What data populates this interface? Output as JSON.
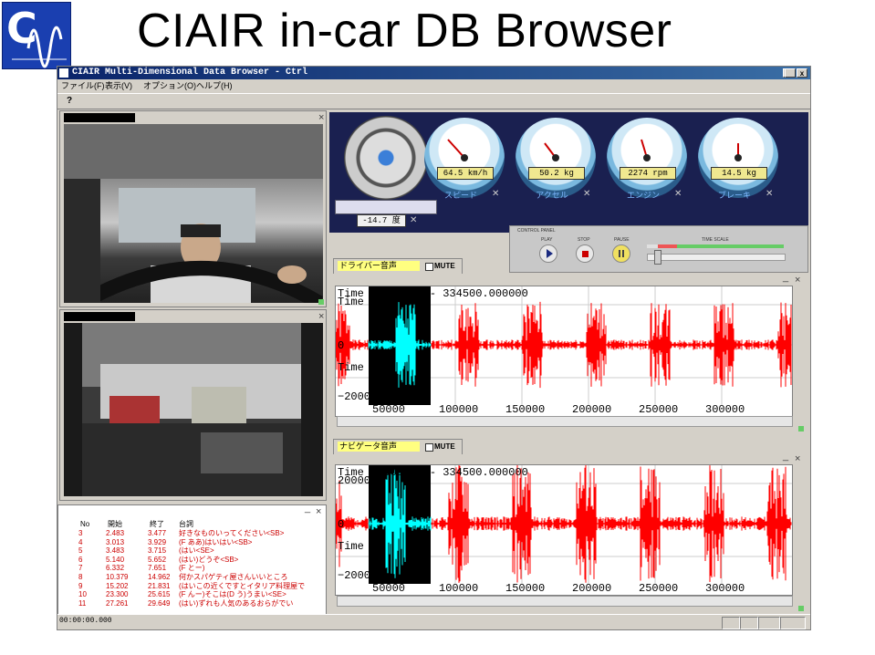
{
  "slide": {
    "title": "CIAIR in-car DB Browser"
  },
  "window": {
    "title": "CIAIR Multi-Dimensional Data Browser - Ctrl",
    "controls": [
      "_",
      "«",
      "x"
    ],
    "menu": [
      "ファイル(F)",
      "表示(V)",
      "オプション(O)",
      "ヘルプ(H)"
    ],
    "help_icon": "?"
  },
  "gauges": {
    "steering": {
      "value": "-14.7 度"
    },
    "dials": [
      {
        "value": "64.5 km/h",
        "label": "スピード",
        "icon": "speed-gauge-icon"
      },
      {
        "value": "50.2 kg",
        "label": "アクセル",
        "icon": "accel-gauge-icon"
      },
      {
        "value": "2274 rpm",
        "label": "エンジン",
        "icon": "engine-gauge-icon"
      },
      {
        "value": "14.5 kg",
        "label": "ブレーキ",
        "icon": "brake-gauge-icon"
      }
    ]
  },
  "control_panel": {
    "title": "CONTROL PANEL",
    "play": "PLAY",
    "stop": "STOP",
    "pause": "PAUSE",
    "time_scale": "TIME SCALE"
  },
  "waves": [
    {
      "tab": "ドライバー音声",
      "mute": "MUTE",
      "time": "Time 0.000000 - 334500.000000",
      "y_labels": [
        "Time",
        "0",
        "Time",
        "−20000"
      ],
      "x_ticks": [
        "50000",
        "100000",
        "150000",
        "200000",
        "250000",
        "300000"
      ]
    },
    {
      "tab": "ナビゲータ音声",
      "mute": "MUTE",
      "time": "Time 0.000000 - 334500.000000",
      "y_labels": [
        "20000",
        "0",
        "Time",
        "−20000"
      ],
      "x_ticks": [
        "50000",
        "100000",
        "150000",
        "200000",
        "250000",
        "300000"
      ]
    }
  ],
  "transcript": {
    "headers": [
      "No",
      "開始",
      "終了",
      "台詞"
    ],
    "rows": [
      [
        "3",
        "2.483",
        "3.477",
        "好きなものいってください<SB>"
      ],
      [
        "4",
        "3.013",
        "3.929",
        "(F ああ)はいはい<SB>"
      ],
      [
        "5",
        "3.483",
        "3.715",
        "(はい<SE>"
      ],
      [
        "6",
        "5.140",
        "5.652",
        "(はい)どうぞ<SB>"
      ],
      [
        "7",
        "6.332",
        "7.651",
        "(F とー)"
      ],
      [
        "8",
        "10.379",
        "14.962",
        "何かスパゲティ屋さんいいところ"
      ],
      [
        "9",
        "15.202",
        "21.831",
        "(はいこの近くですとイタリア料理屋で"
      ],
      [
        "10",
        "23.300",
        "25.615",
        "(F んー)そこは(D う)うまい<SE>"
      ],
      [
        "11",
        "27.261",
        "29.649",
        "(はい)ずれも人気のあるおらがでい"
      ]
    ]
  },
  "status": {
    "time": "00:00:00.000"
  }
}
